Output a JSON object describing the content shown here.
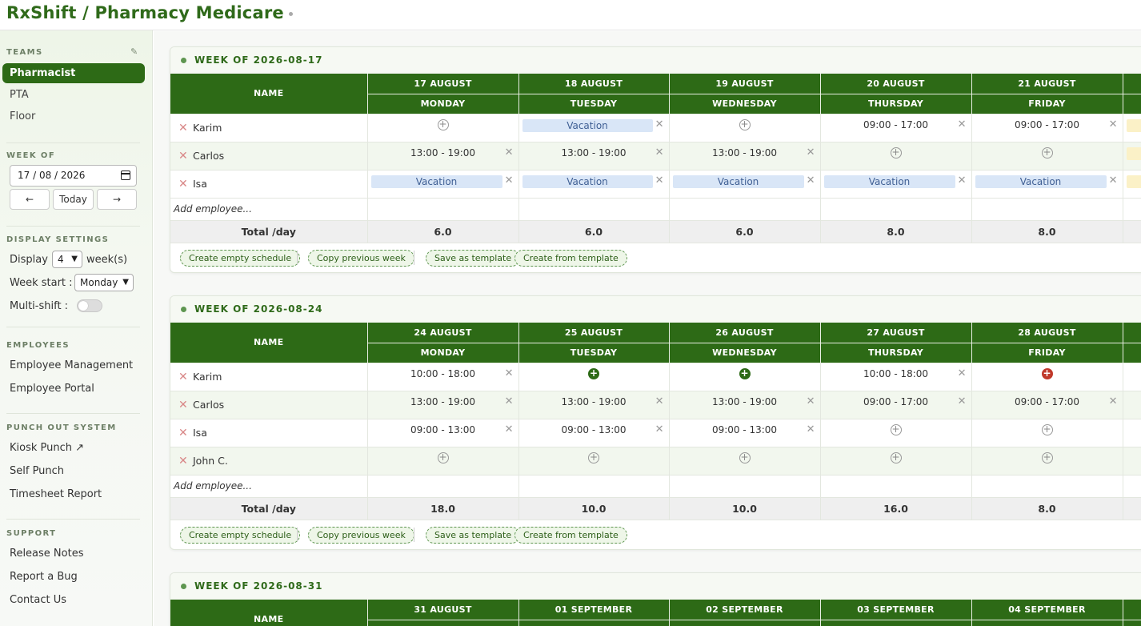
{
  "app": {
    "title": "RxShift / Pharmacy Medicare"
  },
  "sidebar": {
    "teams_label": "TEAMS",
    "teams": [
      "Pharmacist",
      "PTA",
      "Floor"
    ],
    "week_of_label": "WEEK OF",
    "week_of_value": "17 / 08 / 2026",
    "prev_label": "←",
    "today_label": "Today",
    "next_label": "→",
    "display_label": "DISPLAY SETTINGS",
    "display_text": "Display",
    "display_value": "4",
    "weeks_suffix": "week(s)",
    "week_start_text": "Week start :",
    "week_start_value": "Monday",
    "multishift_text": "Multi-shift :",
    "employees_label": "EMPLOYEES",
    "employee_management": "Employee Management",
    "employee_portal": "Employee Portal",
    "punch_label": "PUNCH OUT SYSTEM",
    "kiosk_punch": "Kiosk Punch ↗",
    "self_punch": "Self Punch",
    "timesheet_report": "Timesheet Report",
    "support_label": "SUPPORT",
    "release_notes": "Release Notes",
    "report_bug": "Report a Bug",
    "contact_us": "Contact Us"
  },
  "schedule": {
    "name_header": "NAME",
    "add_employee": "Add employee...",
    "total_label": "Total /day",
    "actions": {
      "create_empty": "Create empty schedule",
      "copy_previous": "Copy previous week",
      "save_template": "Save as template",
      "create_template": "Create from template"
    },
    "vacation_label": "Vacation",
    "weeks": [
      {
        "title": "WEEK OF 2026-08-17",
        "dates": [
          "17 AUGUST",
          "18 AUGUST",
          "19 AUGUST",
          "20 AUGUST",
          "21 AUGUST"
        ],
        "days": [
          "MONDAY",
          "TUESDAY",
          "WEDNESDAY",
          "THURSDAY",
          "FRIDAY"
        ],
        "rows": [
          {
            "name": "Karim",
            "cells": [
              "+",
              "Vacation",
              "+",
              "09:00 - 17:00",
              "09:00 - 17:00"
            ]
          },
          {
            "name": "Carlos",
            "cells": [
              "13:00 - 19:00",
              "13:00 - 19:00",
              "13:00 - 19:00",
              "+",
              "+"
            ]
          },
          {
            "name": "Isa",
            "cells": [
              "Vacation",
              "Vacation",
              "Vacation",
              "Vacation",
              "Vacation"
            ]
          }
        ],
        "totals": [
          "6.0",
          "6.0",
          "6.0",
          "8.0",
          "8.0"
        ]
      },
      {
        "title": "WEEK OF 2026-08-24",
        "dates": [
          "24 AUGUST",
          "25 AUGUST",
          "26 AUGUST",
          "27 AUGUST",
          "28 AUGUST"
        ],
        "days": [
          "MONDAY",
          "TUESDAY",
          "WEDNESDAY",
          "THURSDAY",
          "FRIDAY"
        ],
        "rows": [
          {
            "name": "Karim",
            "cells": [
              "10:00 - 18:00",
              "+green",
              "+green",
              "10:00 - 18:00",
              "+red"
            ]
          },
          {
            "name": "Carlos",
            "cells": [
              "13:00 - 19:00",
              "13:00 - 19:00",
              "13:00 - 19:00",
              "09:00 - 17:00",
              "09:00 - 17:00"
            ]
          },
          {
            "name": "Isa",
            "cells": [
              "09:00 - 13:00",
              "09:00 - 13:00",
              "09:00 - 13:00",
              "+",
              "+"
            ]
          },
          {
            "name": "John C.",
            "cells": [
              "+",
              "+",
              "+",
              "+",
              "+"
            ]
          }
        ],
        "totals": [
          "18.0",
          "10.0",
          "10.0",
          "16.0",
          "8.0"
        ]
      },
      {
        "title": "WEEK OF 2026-08-31",
        "dates": [
          "31 AUGUST",
          "01 SEPTEMBER",
          "02 SEPTEMBER",
          "03 SEPTEMBER",
          "04 SEPTEMBER"
        ],
        "days": [],
        "rows": [],
        "totals": []
      }
    ]
  },
  "colors": {
    "brand": "#2d6a16",
    "vacation": "#d9e6f7",
    "danger": "#c0392b"
  }
}
